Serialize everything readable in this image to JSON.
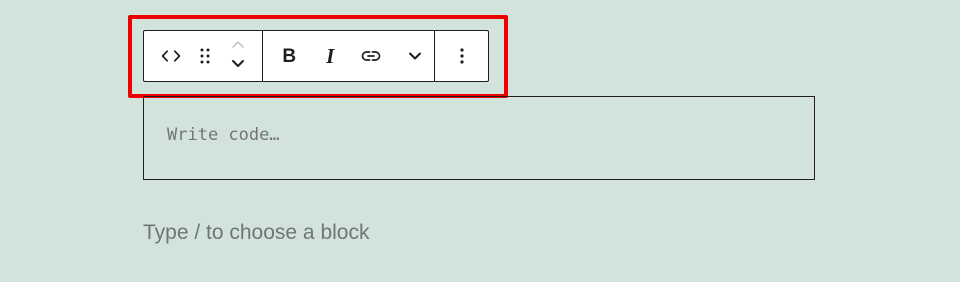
{
  "toolbar": {
    "block_type_icon": "code-icon",
    "drag_handle_icon": "drag-handle-icon",
    "move_up_icon": "chevron-up-icon",
    "move_down_icon": "chevron-down-icon",
    "bold_label": "B",
    "italic_label": "I",
    "link_icon": "link-icon",
    "more_rich_text_icon": "chevron-down-icon",
    "options_icon": "more-vertical-icon"
  },
  "code_block": {
    "placeholder": "Write code…"
  },
  "paragraph": {
    "placeholder": "Type / to choose a block"
  },
  "colors": {
    "background": "#d2e3dc",
    "highlight": "#ee0000",
    "toolbar_border": "#1e1e1e",
    "placeholder_text": "#757575"
  }
}
